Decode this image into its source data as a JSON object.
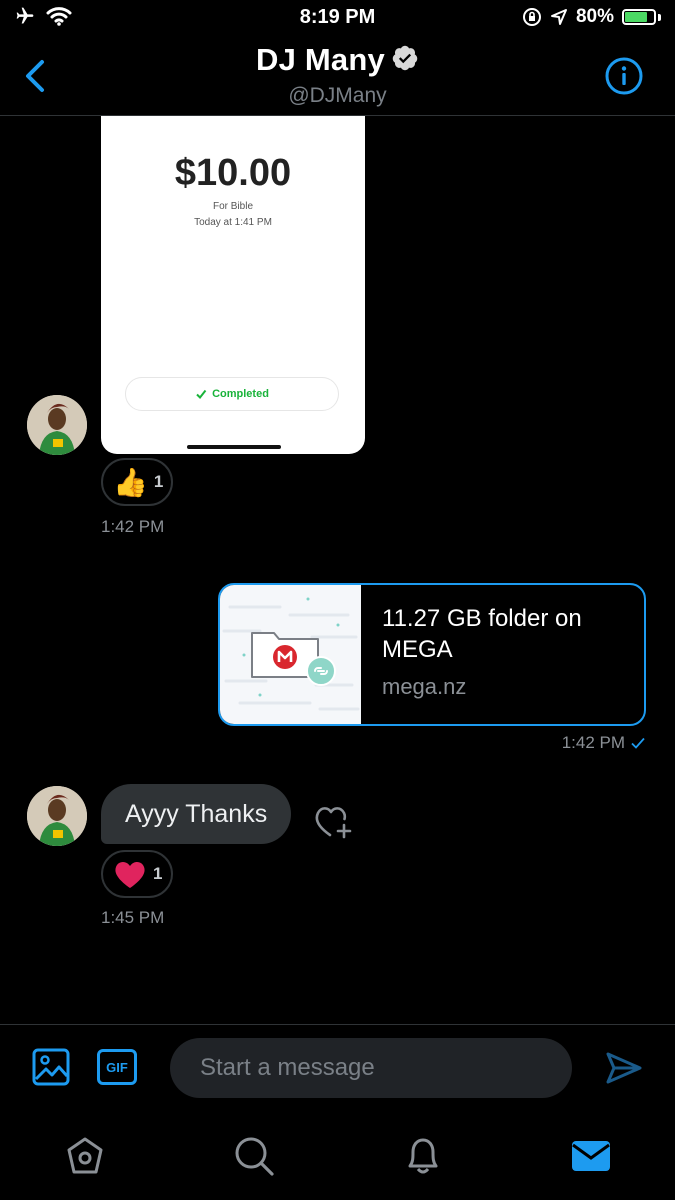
{
  "status_bar": {
    "time": "8:19 PM",
    "battery": "80%",
    "battery_level": 0.8
  },
  "header": {
    "name": "DJ Many",
    "handle": "@DJMany"
  },
  "messages": {
    "image_receipt": {
      "amount": "$10.00",
      "note": "For Bible",
      "date": "Today at 1:41 PM",
      "status": "Completed"
    },
    "reaction_1": {
      "emoji": "👍",
      "count": "1"
    },
    "time_1": "1:42 PM",
    "link_card": {
      "title": "11.27 GB folder on MEGA",
      "domain": "mega.nz"
    },
    "time_2": "1:42 PM",
    "bubble_text": "Ayyy Thanks",
    "reaction_2": {
      "emoji": "❤️",
      "count": "1"
    },
    "time_3": "1:45 PM"
  },
  "composer": {
    "gif_label": "GIF",
    "placeholder": "Start a message"
  },
  "colors": {
    "accent": "#1d9bf0",
    "background": "#000000",
    "bubble": "#2f3336",
    "heart": "#e0245e",
    "mega_red": "#d9272e"
  }
}
